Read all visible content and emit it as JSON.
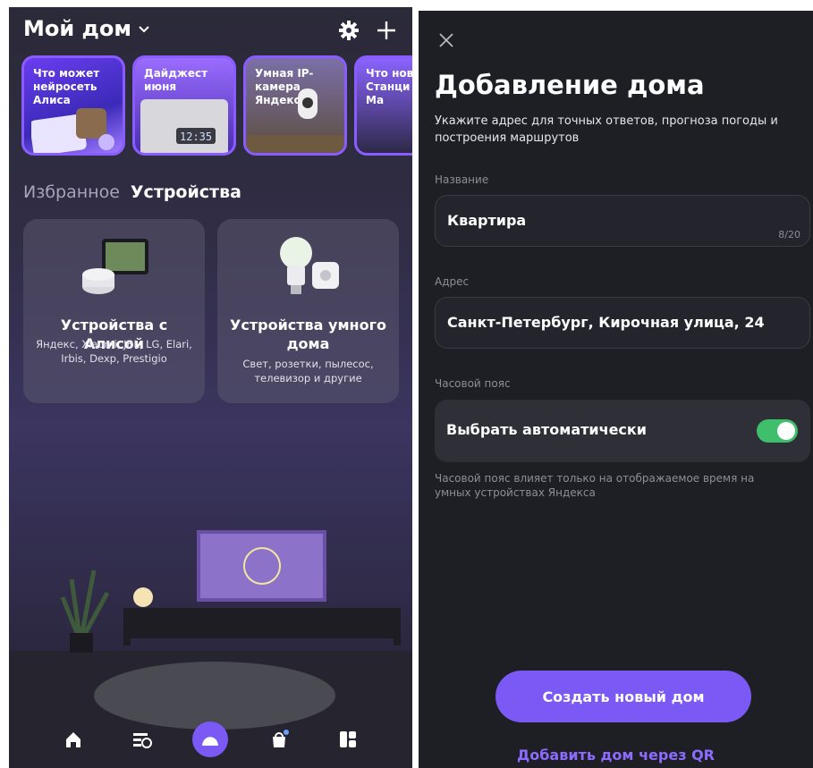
{
  "left": {
    "home_title": "Мой дом",
    "stories": [
      {
        "text": "Что может нейросеть Алиса"
      },
      {
        "text": "Дайджест июня"
      },
      {
        "text": "Умная IP-камера Яндекса"
      },
      {
        "text": "Что нов Станци Дуо Ма"
      }
    ],
    "tabs": [
      {
        "label": "Избранное",
        "active": false
      },
      {
        "label": "Устройства",
        "active": true
      }
    ],
    "cards": [
      {
        "title": "Устройства с Алисой",
        "subtitle": "Яндекс, Xiaomi, JBL, LG, Elari, Irbis, Dexp, Prestigio"
      },
      {
        "title": "Устройства умного дома",
        "subtitle": "Свет, розетки, пылесос, телевизор и другие"
      }
    ],
    "nav": [
      "home-icon",
      "devices-scenarios-icon",
      "alice-icon",
      "shop-icon",
      "widgets-icon"
    ]
  },
  "right": {
    "title": "Добавление дома",
    "subtitle": "Укажите адрес для точных ответов, прогноза погоды и построения маршрутов",
    "name_label": "Название",
    "name_value": "Квартира",
    "name_counter": "8/20",
    "address_label": "Адрес",
    "address_value": "Санкт-Петербург, Кирочная улица, 24",
    "tz_section_label": "Часовой пояс",
    "tz_auto_label": "Выбрать автоматически",
    "tz_auto_on": true,
    "tz_note": "Часовой пояс влияет только на отображаемое время на умных устройствах Яндекса",
    "create_button": "Создать новый дом",
    "qr_link": "Добавить дом через QR"
  },
  "colors": {
    "accent": "#7a59f5",
    "link": "#8d6bff",
    "toggle_on": "#3fbf6c",
    "right_bg": "#1e1f25"
  }
}
